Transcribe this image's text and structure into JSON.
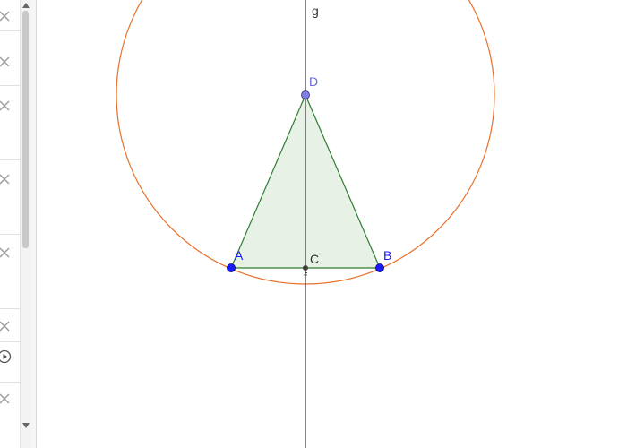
{
  "algebra_view": {
    "items": [
      {
        "icon": "close-icon"
      },
      {
        "icon": "close-icon"
      },
      {
        "icon": "close-icon"
      },
      {
        "icon": "close-icon"
      },
      {
        "icon": "close-icon"
      },
      {
        "icon": "close-icon"
      },
      {
        "icon": "play-icon"
      },
      {
        "icon": "close-icon"
      }
    ]
  },
  "graphics": {
    "labels": {
      "g": "g",
      "D": "D",
      "A": "A",
      "B": "B",
      "C": "C",
      "f": "f"
    },
    "colors": {
      "circle": "#e8702a",
      "triangle_stroke": "#2e7d32",
      "triangle_fill": "#e3efe0",
      "point_free": "#1a1aff",
      "point_dependent": "#7f7fe6",
      "point_midpoint": "#404040",
      "line": "#333333",
      "label_blue": "#1a1aff",
      "label_purple": "#6666dd",
      "label_dark": "#333333"
    }
  }
}
